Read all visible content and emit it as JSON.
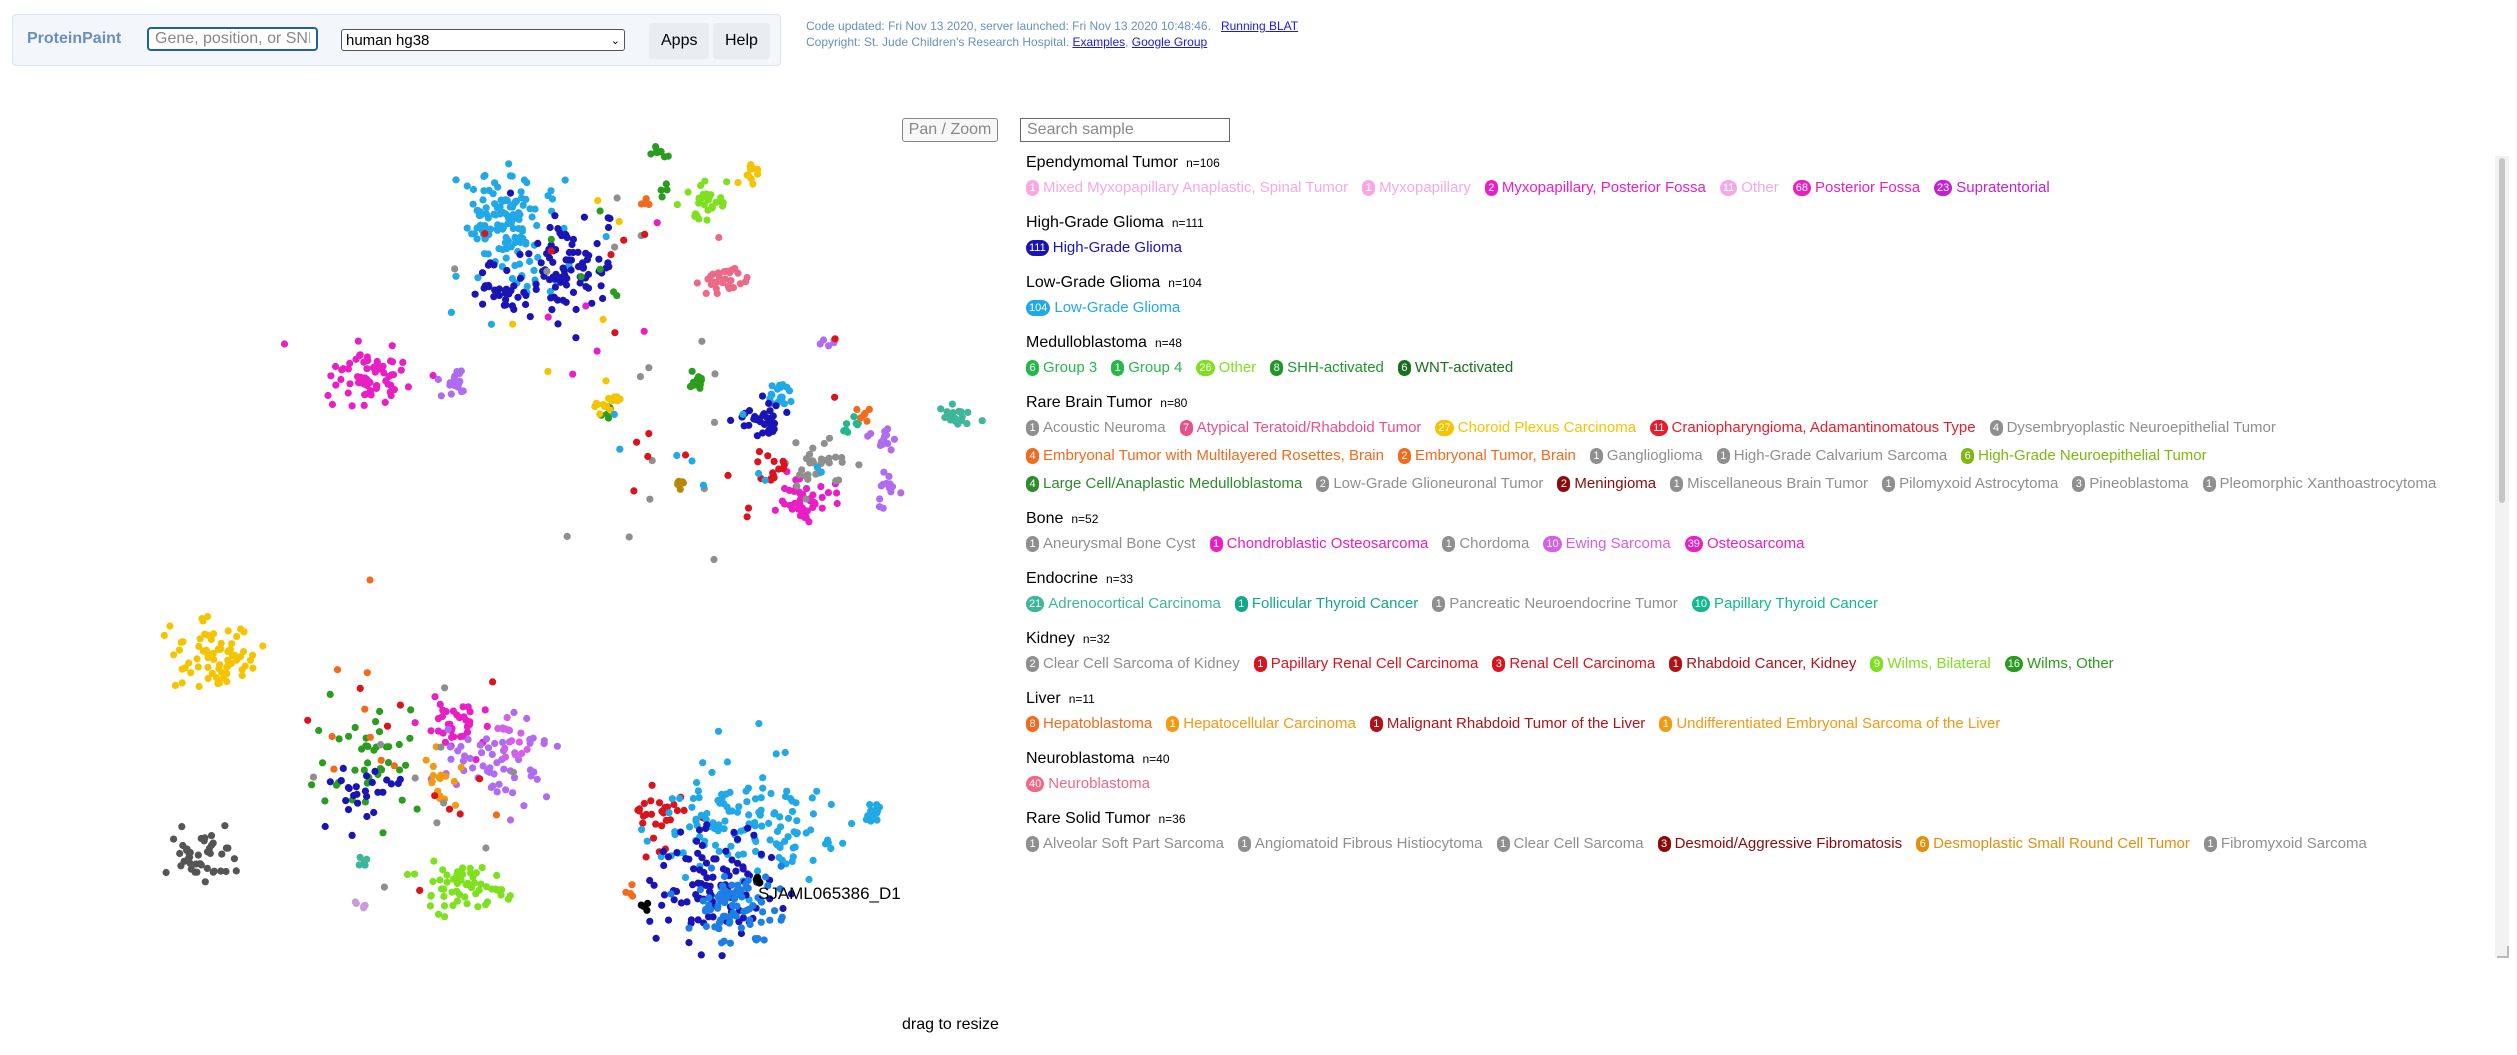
{
  "header": {
    "logo": "ProteinPaint",
    "search_placeholder": "Gene, position, or SNP",
    "genome": "human hg38",
    "apps_label": "Apps",
    "help_label": "Help",
    "info_line1": "Code updated: Fri Nov 13 2020, server launched: Fri Nov 13 2020 10:48:46.",
    "blat_label": "Running BLAT",
    "info_line2": "Copyright: St. Jude Children's Research Hospital.",
    "examples_label": "Examples",
    "google_group_label": "Google Group"
  },
  "controls": {
    "pan_zoom_label": "Pan / Zoom",
    "sample_search_placeholder": "Search sample"
  },
  "scatter": {
    "highlight_sample": "SJAML065386_D1"
  },
  "legend": {
    "groups": [
      {
        "name": "Ependymomal Tumor",
        "n": "n=106",
        "items": [
          {
            "count": "1",
            "label": "Mixed Myxopapillary Anaplastic, Spinal Tumor",
            "color": "#f5a8e8"
          },
          {
            "count": "1",
            "label": "Myxopapillary",
            "color": "#f5a8e8"
          },
          {
            "count": "2",
            "label": "Myxopapillary, Posterior Fossa",
            "color": "#e81fc4"
          },
          {
            "count": "11",
            "label": "Other",
            "color": "#f5a8e8"
          },
          {
            "count": "68",
            "label": "Posterior Fossa",
            "color": "#e81fc4"
          },
          {
            "count": "23",
            "label": "Supratentorial",
            "color": "#c21fd6"
          }
        ]
      },
      {
        "name": "High-Grade Glioma",
        "n": "n=111",
        "items": [
          {
            "count": "111",
            "label": "High-Grade Glioma",
            "color": "#1a14b5"
          }
        ]
      },
      {
        "name": "Low-Grade Glioma",
        "n": "n=104",
        "items": [
          {
            "count": "104",
            "label": "Low-Grade Glioma",
            "color": "#21a8e6"
          }
        ]
      },
      {
        "name": "Medulloblastoma",
        "n": "n=48",
        "items": [
          {
            "count": "6",
            "label": "Group 3",
            "color": "#25b84a"
          },
          {
            "count": "1",
            "label": "Group 4",
            "color": "#25b84a"
          },
          {
            "count": "26",
            "label": "Other",
            "color": "#7ee01e"
          },
          {
            "count": "8",
            "label": "SHH-activated",
            "color": "#1e9628"
          },
          {
            "count": "6",
            "label": "WNT-activated",
            "color": "#1a6e1e"
          }
        ]
      },
      {
        "name": "Rare Brain Tumor",
        "n": "n=80",
        "items": [
          {
            "count": "1",
            "label": "Acoustic Neuroma",
            "color": "#8f8f8f"
          },
          {
            "count": "7",
            "label": "Atypical Teratoid/Rhabdoid Tumor",
            "color": "#e8508a"
          },
          {
            "count": "27",
            "label": "Choroid Plexus Carcinoma",
            "color": "#f5c400"
          },
          {
            "count": "11",
            "label": "Craniopharyngioma, Adamantinomatous Type",
            "color": "#e81c2c"
          },
          {
            "count": "4",
            "label": "Dysembryoplastic Neuroepithelial Tumor",
            "color": "#8f8f8f"
          },
          {
            "count": "4",
            "label": "Embryonal Tumor with Multilayered Rosettes, Brain",
            "color": "#f26a1b"
          },
          {
            "count": "2",
            "label": "Embryonal Tumor, Brain",
            "color": "#f26a1b"
          },
          {
            "count": "1",
            "label": "Ganglioglioma",
            "color": "#8f8f8f"
          },
          {
            "count": "1",
            "label": "High-Grade Calvarium Sarcoma",
            "color": "#8f8f8f"
          },
          {
            "count": "6",
            "label": "High-Grade Neuroepithelial Tumor",
            "color": "#7cb810"
          },
          {
            "count": "4",
            "label": "Large Cell/Anaplastic Medulloblastoma",
            "color": "#2e8b2e"
          },
          {
            "count": "2",
            "label": "Low-Grade Glioneuronal Tumor",
            "color": "#8f8f8f"
          },
          {
            "count": "2",
            "label": "Meningioma",
            "color": "#8b0a0a"
          },
          {
            "count": "1",
            "label": "Miscellaneous Brain Tumor",
            "color": "#8f8f8f"
          },
          {
            "count": "1",
            "label": "Pilomyxoid Astrocytoma",
            "color": "#8f8f8f"
          },
          {
            "count": "3",
            "label": "Pineoblastoma",
            "color": "#8f8f8f"
          },
          {
            "count": "1",
            "label": "Pleomorphic Xanthoastrocytoma",
            "color": "#8f8f8f"
          }
        ]
      },
      {
        "name": "Bone",
        "n": "n=52",
        "items": [
          {
            "count": "1",
            "label": "Aneurysmal Bone Cyst",
            "color": "#8f8f8f"
          },
          {
            "count": "1",
            "label": "Chondroblastic Osteosarcoma",
            "color": "#e81fc4"
          },
          {
            "count": "1",
            "label": "Chordoma",
            "color": "#8f8f8f"
          },
          {
            "count": "10",
            "label": "Ewing Sarcoma",
            "color": "#d65ee8"
          },
          {
            "count": "39",
            "label": "Osteosarcoma",
            "color": "#e81fc4"
          }
        ]
      },
      {
        "name": "Endocrine",
        "n": "n=33",
        "items": [
          {
            "count": "21",
            "label": "Adrenocortical Carcinoma",
            "color": "#3fb59a"
          },
          {
            "count": "1",
            "label": "Follicular Thyroid Cancer",
            "color": "#12a88a"
          },
          {
            "count": "1",
            "label": "Pancreatic Neuroendocrine Tumor",
            "color": "#8f8f8f"
          },
          {
            "count": "10",
            "label": "Papillary Thyroid Cancer",
            "color": "#12b88e"
          }
        ]
      },
      {
        "name": "Kidney",
        "n": "n=32",
        "items": [
          {
            "count": "2",
            "label": "Clear Cell Sarcoma of Kidney",
            "color": "#8f8f8f"
          },
          {
            "count": "1",
            "label": "Papillary Renal Cell Carcinoma",
            "color": "#d9141e"
          },
          {
            "count": "3",
            "label": "Renal Cell Carcinoma",
            "color": "#d9141e"
          },
          {
            "count": "1",
            "label": "Rhabdoid Cancer, Kidney",
            "color": "#b01218"
          },
          {
            "count": "9",
            "label": "Wilms, Bilateral",
            "color": "#7ee01e"
          },
          {
            "count": "16",
            "label": "Wilms, Other",
            "color": "#2a9c1e"
          }
        ]
      },
      {
        "name": "Liver",
        "n": "n=11",
        "items": [
          {
            "count": "8",
            "label": "Hepatoblastoma",
            "color": "#f26a1b"
          },
          {
            "count": "1",
            "label": "Hepatocellular Carcinoma",
            "color": "#f29a12"
          },
          {
            "count": "1",
            "label": "Malignant Rhabdoid Tumor of the Liver",
            "color": "#b01218"
          },
          {
            "count": "1",
            "label": "Undifferentiated Embryonal Sarcoma of the Liver",
            "color": "#f29a12"
          }
        ]
      },
      {
        "name": "Neuroblastoma",
        "n": "n=40",
        "items": [
          {
            "count": "40",
            "label": "Neuroblastoma",
            "color": "#ec6a86"
          }
        ]
      },
      {
        "name": "Rare Solid Tumor",
        "n": "n=36",
        "items": [
          {
            "count": "1",
            "label": "Alveolar Soft Part Sarcoma",
            "color": "#8f8f8f"
          },
          {
            "count": "1",
            "label": "Angiomatoid Fibrous Histiocytoma",
            "color": "#8f8f8f"
          },
          {
            "count": "1",
            "label": "Clear Cell Sarcoma",
            "color": "#8f8f8f"
          },
          {
            "count": "3",
            "label": "Desmoid/Aggressive Fibromatosis",
            "color": "#8b0a0a"
          },
          {
            "count": "6",
            "label": "Desmoplastic Small Round Cell Tumor",
            "color": "#e0900e"
          },
          {
            "count": "1",
            "label": "Fibromyxoid Sarcoma",
            "color": "#8f8f8f"
          }
        ]
      }
    ]
  },
  "footer": {
    "drag_label": "drag to resize"
  }
}
